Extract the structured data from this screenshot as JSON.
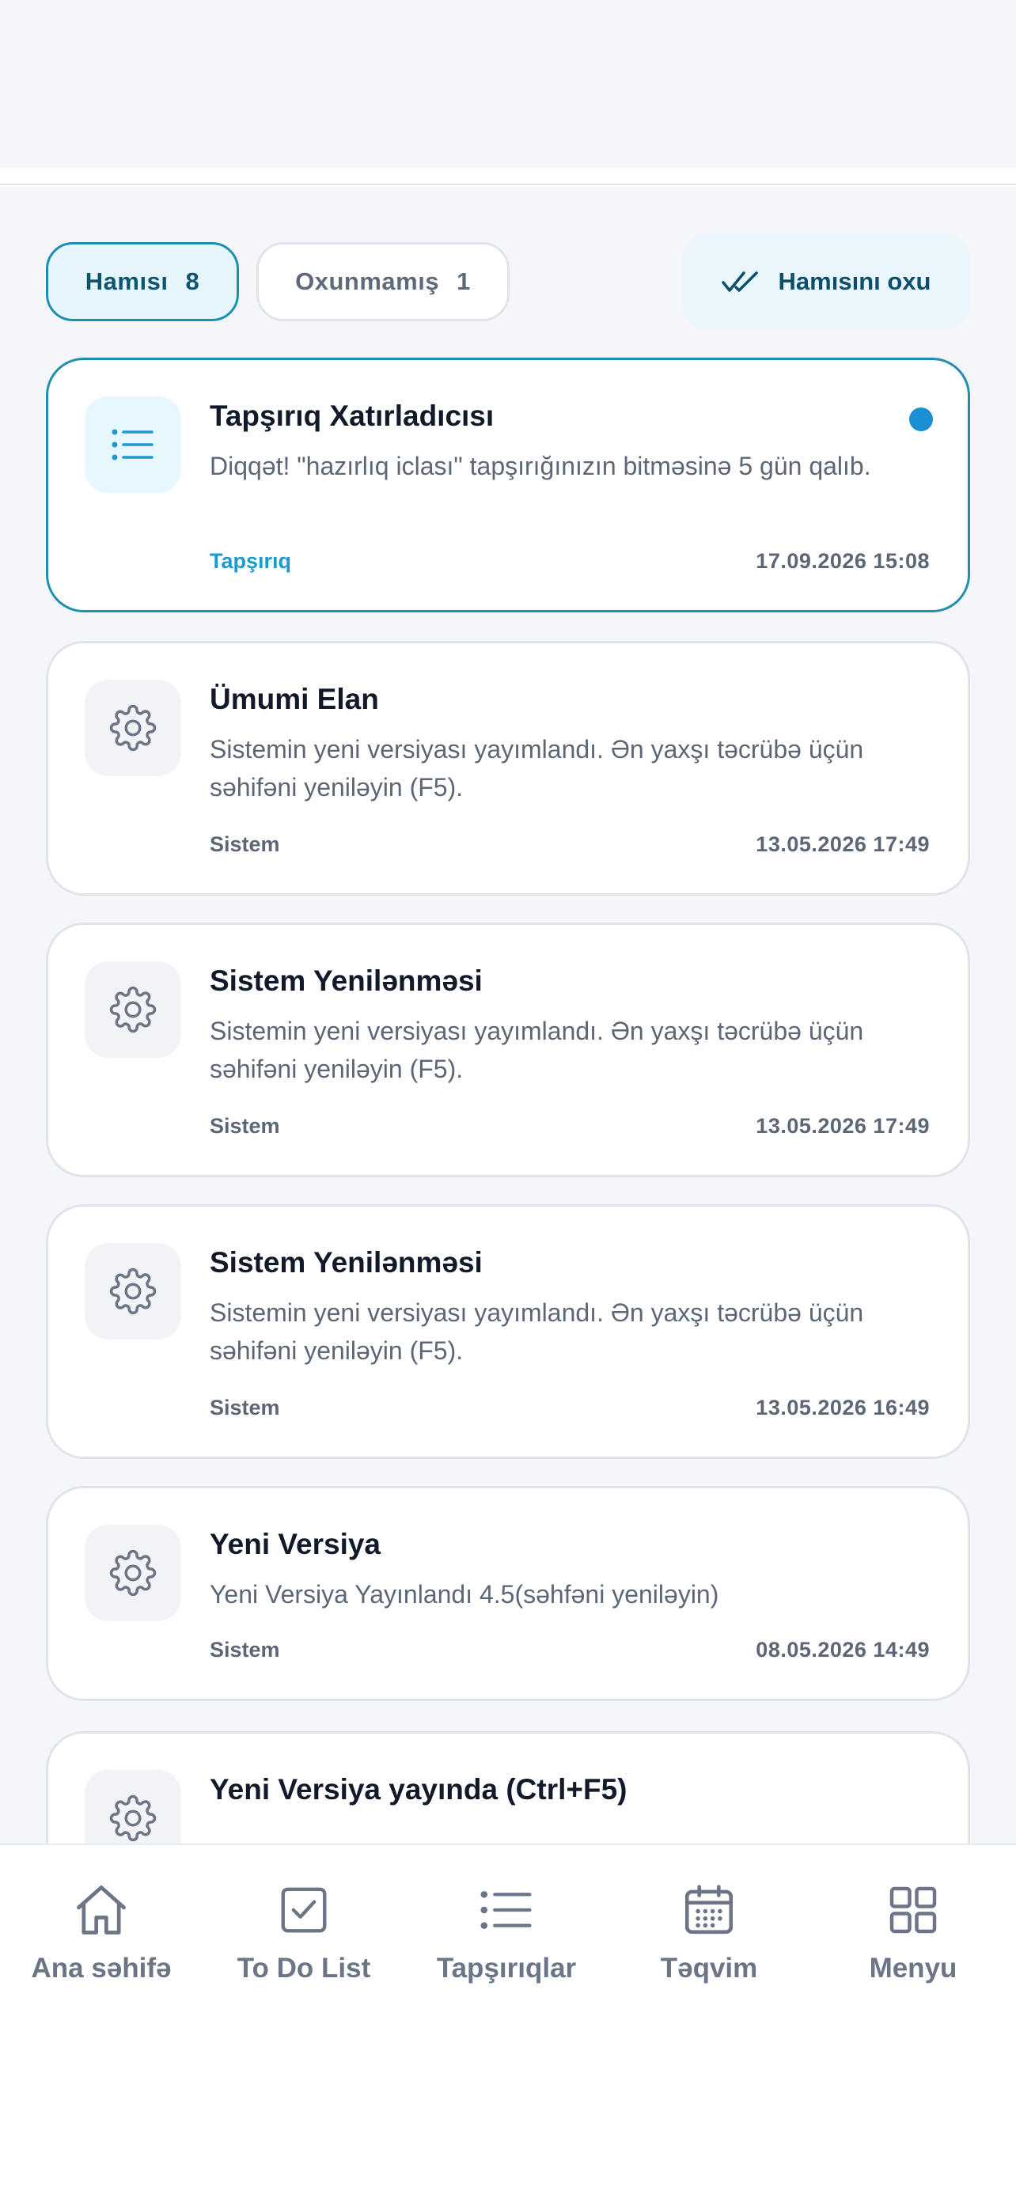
{
  "filters": {
    "all_label": "Hamısı",
    "all_count": "8",
    "unread_label": "Oxunmamış",
    "unread_count": "1",
    "read_all_label": "Hamısını oxu"
  },
  "notifications": [
    {
      "title": "Tapşırıq Xatırladıcısı",
      "message": "Diqqət! \"hazırlıq iclası\" tapşırığınızın bitməsinə 5 gün qalıb.",
      "category": "Tapşırıq",
      "time": "17.09.2026 15:08",
      "icon": "list-icon",
      "unread": true
    },
    {
      "title": "Ümumi Elan",
      "message": "Sistemin yeni versiyası yayımlandı. Ən yaxşı təcrübə üçün səhifəni yeniləyin (F5).",
      "category": "Sistem",
      "time": "13.05.2026 17:49",
      "icon": "gear-icon",
      "unread": false
    },
    {
      "title": "Sistem Yenilənməsi",
      "message": "Sistemin yeni versiyası yayımlandı. Ən yaxşı təcrübə üçün səhifəni yeniləyin (F5).",
      "category": "Sistem",
      "time": "13.05.2026 17:49",
      "icon": "gear-icon",
      "unread": false
    },
    {
      "title": "Sistem Yenilənməsi",
      "message": "Sistemin yeni versiyası yayımlandı. Ən yaxşı təcrübə üçün səhifəni yeniləyin (F5).",
      "category": "Sistem",
      "time": "13.05.2026 16:49",
      "icon": "gear-icon",
      "unread": false
    },
    {
      "title": "Yeni Versiya",
      "message": "Yeni Versiya Yayınlandı 4.5(səhfəni yeniləyin)",
      "category": "Sistem",
      "time": "08.05.2026 14:49",
      "icon": "gear-icon",
      "unread": false
    },
    {
      "title": "Yeni Versiya yayında (Ctrl+F5)",
      "message": "",
      "category": "",
      "time": "",
      "icon": "gear-icon",
      "unread": false
    }
  ],
  "nav": {
    "home": "Ana səhifə",
    "todo": "To Do List",
    "tasks": "Tapşırıqlar",
    "calendar": "Təqvim",
    "menu": "Menyu"
  },
  "colors": {
    "accent": "#1a8fb0",
    "unread_dot": "#1a8fd4",
    "background": "#f4f6fa"
  }
}
